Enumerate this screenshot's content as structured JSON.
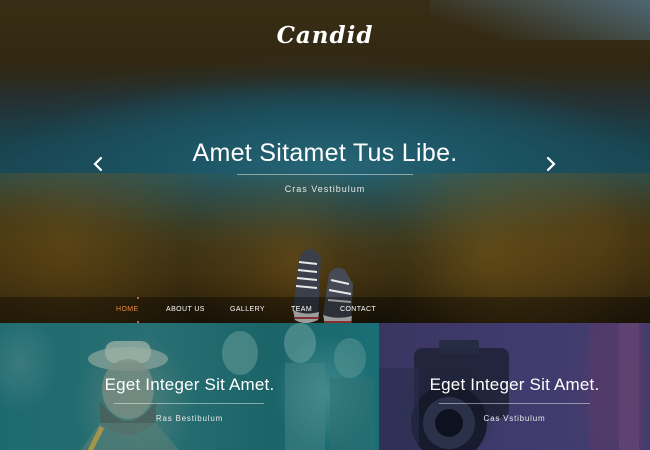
{
  "site": {
    "logo": "Candid"
  },
  "slider": {
    "title": "Amet Sitamet Tus Libe.",
    "subtitle": "Cras Vestibulum",
    "prev_icon": "chevron-left-icon",
    "next_icon": "chevron-right-icon"
  },
  "nav": {
    "active_color": "#f0883d",
    "items": [
      {
        "label": "HOME",
        "active": true
      },
      {
        "label": "ABOUT US",
        "active": false
      },
      {
        "label": "GALLERY",
        "active": false
      },
      {
        "label": "TEAM",
        "active": false
      },
      {
        "label": "CONTACT",
        "active": false
      }
    ]
  },
  "panels": [
    {
      "title": "Eget Integer Sit Amet.",
      "subtitle": "Ras Bestibulum"
    },
    {
      "title": "Eget Integer Sit Amet.",
      "subtitle": "Cas Vstibulum"
    }
  ]
}
